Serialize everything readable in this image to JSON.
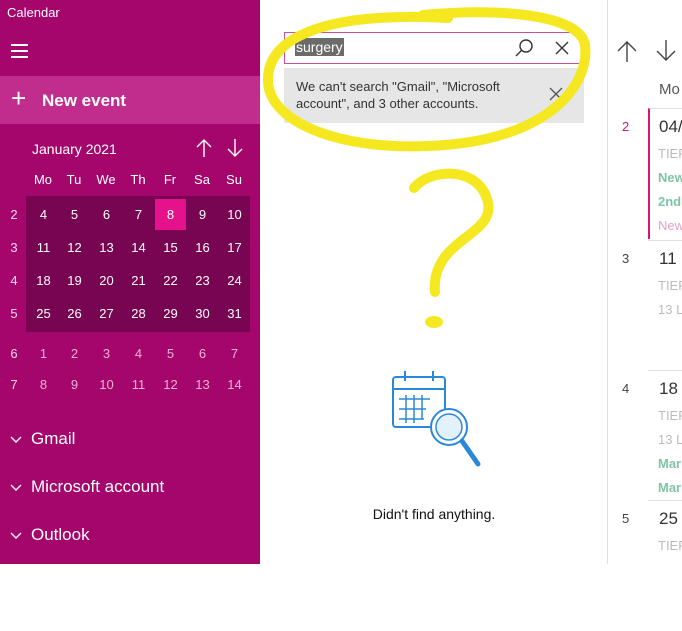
{
  "app": {
    "title": "Calendar"
  },
  "sidebar": {
    "new_event": "New event",
    "mini_calendar": {
      "month_label": "January 2021",
      "weekdays": [
        "Mo",
        "Tu",
        "We",
        "Th",
        "Fr",
        "Sa",
        "Su"
      ],
      "weeks": [
        {
          "num": "2",
          "days": [
            "4",
            "5",
            "6",
            "7",
            "8",
            "9",
            "10"
          ]
        },
        {
          "num": "3",
          "days": [
            "11",
            "12",
            "13",
            "14",
            "15",
            "16",
            "17"
          ]
        },
        {
          "num": "4",
          "days": [
            "18",
            "19",
            "20",
            "21",
            "22",
            "23",
            "24"
          ]
        },
        {
          "num": "5",
          "days": [
            "25",
            "26",
            "27",
            "28",
            "29",
            "30",
            "31"
          ]
        },
        {
          "num": "6",
          "days": [
            "1",
            "2",
            "3",
            "4",
            "5",
            "6",
            "7"
          ]
        },
        {
          "num": "7",
          "days": [
            "8",
            "9",
            "10",
            "11",
            "12",
            "13",
            "14"
          ]
        }
      ],
      "today": "8"
    },
    "accounts": [
      "Gmail",
      "Microsoft account",
      "Outlook"
    ]
  },
  "search": {
    "query": "surgery",
    "notice": "We can't search \"Gmail\", \"Microsoft account\", and 3 other accounts.",
    "empty_text": "Didn't find anything."
  },
  "calendar_strip": {
    "column_header": "Mo",
    "weeks": [
      {
        "week": "2",
        "day": "04/",
        "events": [
          {
            "text": "TIEF",
            "style": "gray"
          },
          {
            "text": "New",
            "style": "green"
          },
          {
            "text": "2nd",
            "style": "green"
          },
          {
            "text": "New",
            "style": "pink"
          }
        ]
      },
      {
        "week": "3",
        "day": "11",
        "events": [
          {
            "text": "TIEF",
            "style": "gray"
          },
          {
            "text": "13 L",
            "style": "gray"
          }
        ]
      },
      {
        "week": "4",
        "day": "18",
        "events": [
          {
            "text": "TIEF",
            "style": "gray"
          },
          {
            "text": "13 L",
            "style": "gray"
          },
          {
            "text": "Mar",
            "style": "green"
          },
          {
            "text": "Mar",
            "style": "green"
          }
        ]
      },
      {
        "week": "5",
        "day": "25",
        "events": [
          {
            "text": "TIEF",
            "style": "gray"
          }
        ]
      }
    ]
  },
  "colors": {
    "sidebar": "#a4066c",
    "accent": "#e6128b",
    "highlight": "#f5e821"
  }
}
